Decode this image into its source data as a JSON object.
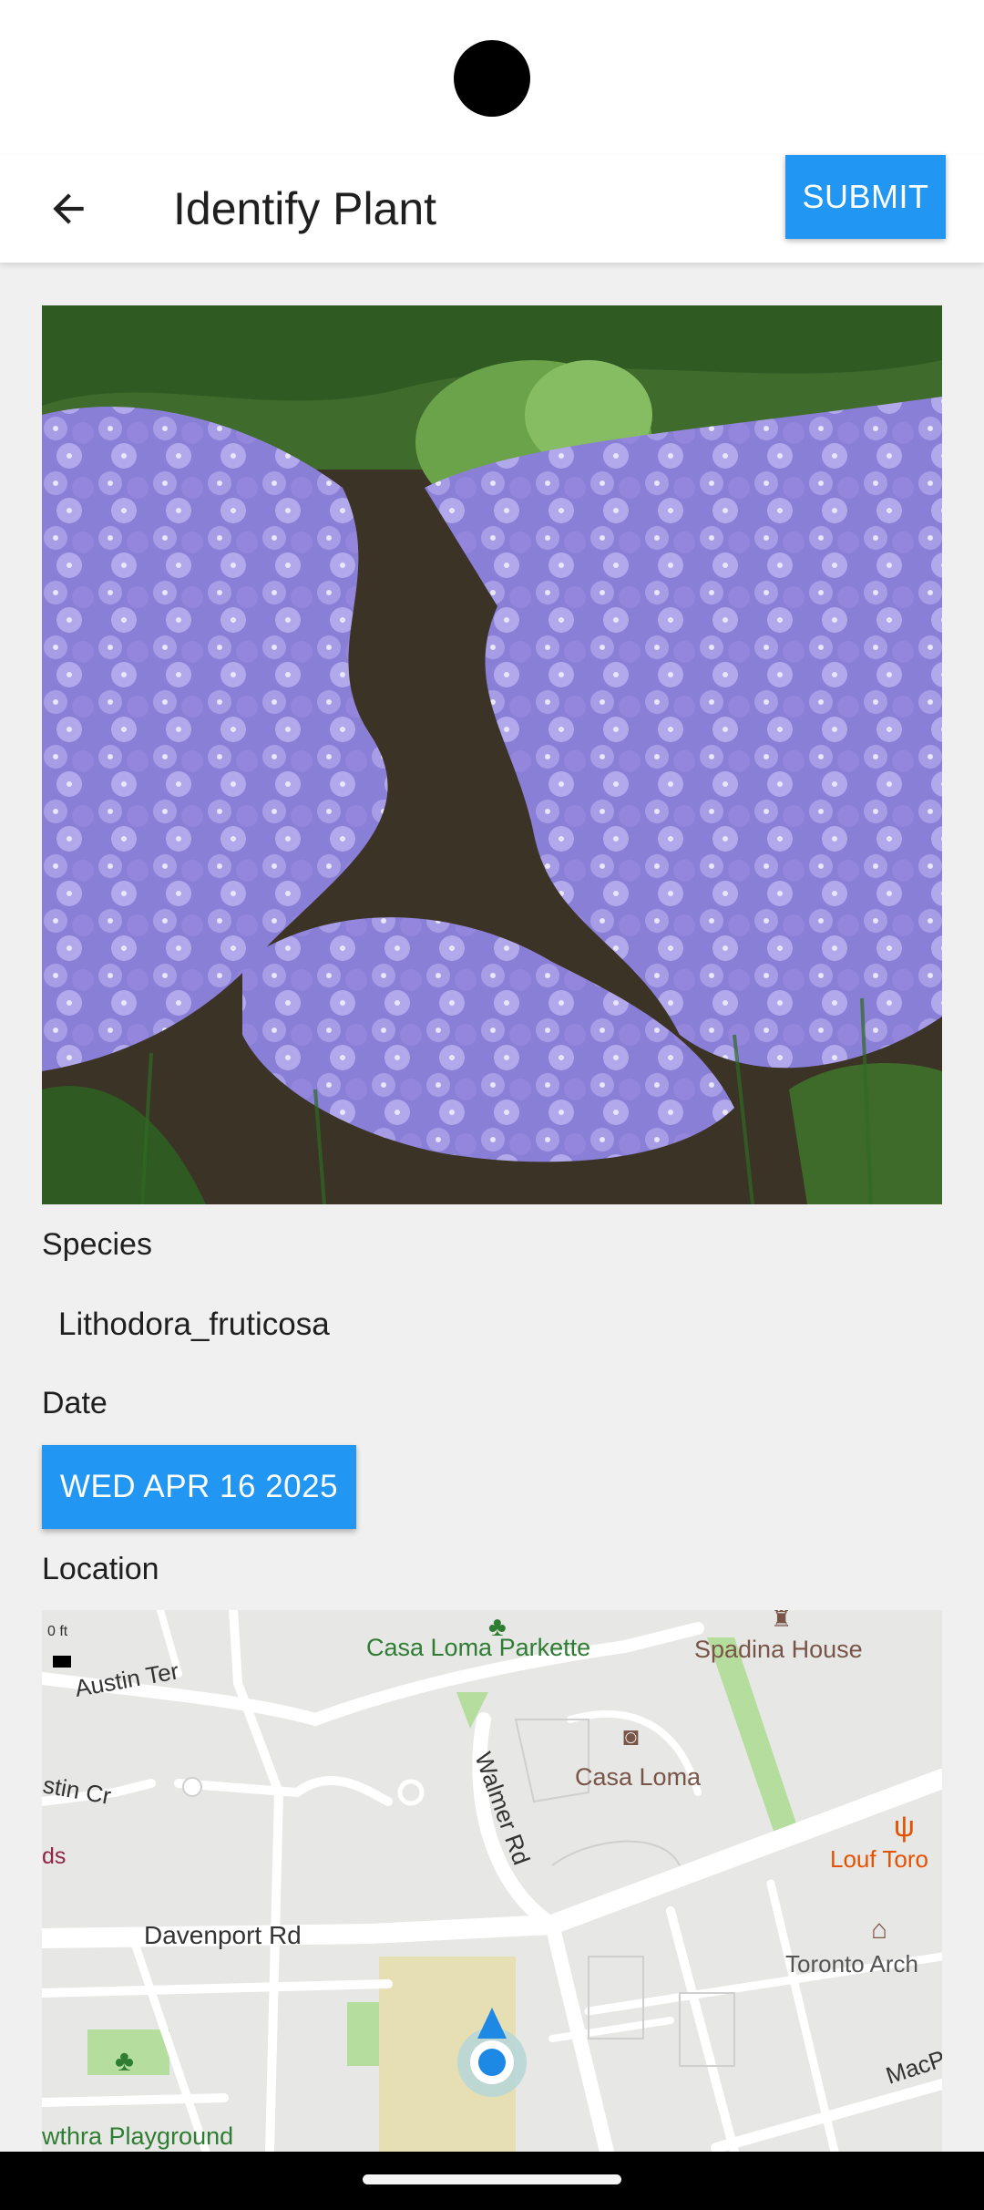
{
  "app_bar": {
    "title": "Identify Plant",
    "submit_label": "SUBMIT",
    "back_icon": "arrow-left-icon"
  },
  "form": {
    "species_label": "Species",
    "species_value": "Lithodora_fruticosa",
    "date_label": "Date",
    "date_value": "WED APR 16 2025",
    "location_label": "Location"
  },
  "map": {
    "scale_text": "0 ft",
    "streets": [
      "Austin Ter",
      "stin Cr",
      "Walmer Rd",
      "Davenport Rd",
      "MacP"
    ],
    "places": [
      "Casa Loma Parkette",
      "Spadina House",
      "Casa Loma",
      "Louf Toro",
      "Toronto Arch",
      "ds",
      "wthra Playground"
    ]
  },
  "colors": {
    "accent": "#2196f3",
    "background": "#f0f0f0",
    "map_green_text": "#2e7d32",
    "map_brown_text": "#795548",
    "map_orange_text": "#e65100"
  }
}
